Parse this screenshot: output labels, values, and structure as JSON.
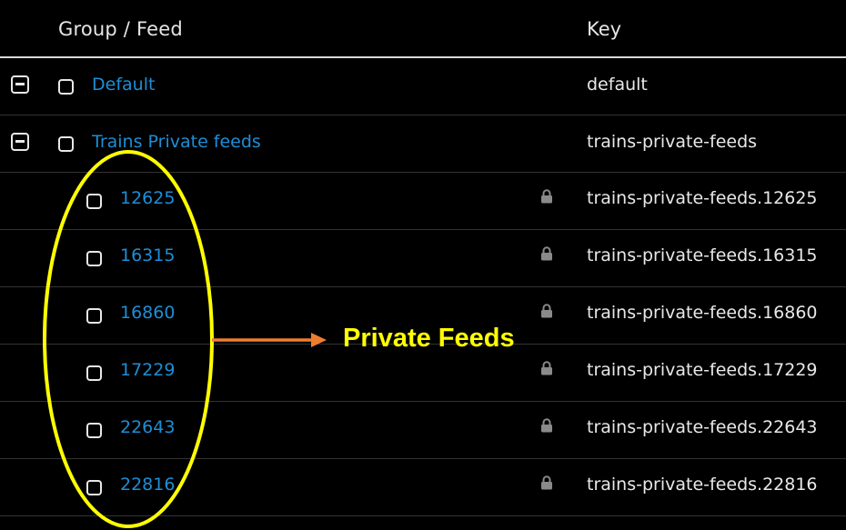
{
  "columns": {
    "group_feed": "Group / Feed",
    "key": "Key"
  },
  "groups": [
    {
      "label": "Default",
      "key": "default",
      "expand_icon": "collapse-icon",
      "feeds": []
    },
    {
      "label": "Trains Private feeds",
      "key": "trains-private-feeds",
      "expand_icon": "collapse-icon",
      "feeds": [
        {
          "label": "12625",
          "key": "trains-private-feeds.12625",
          "private": true
        },
        {
          "label": "16315",
          "key": "trains-private-feeds.16315",
          "private": true
        },
        {
          "label": "16860",
          "key": "trains-private-feeds.16860",
          "private": true
        },
        {
          "label": "17229",
          "key": "trains-private-feeds.17229",
          "private": true
        },
        {
          "label": "22643",
          "key": "trains-private-feeds.22643",
          "private": true
        },
        {
          "label": "22816",
          "key": "trains-private-feeds.22816",
          "private": true
        }
      ]
    }
  ],
  "annotation": {
    "label": "Private Feeds",
    "highlight_color": "#ffff00",
    "arrow_color": "#ed7d31"
  },
  "colors": {
    "link": "#1e8ed6",
    "background": "#000000",
    "text": "#e8e8e8"
  }
}
